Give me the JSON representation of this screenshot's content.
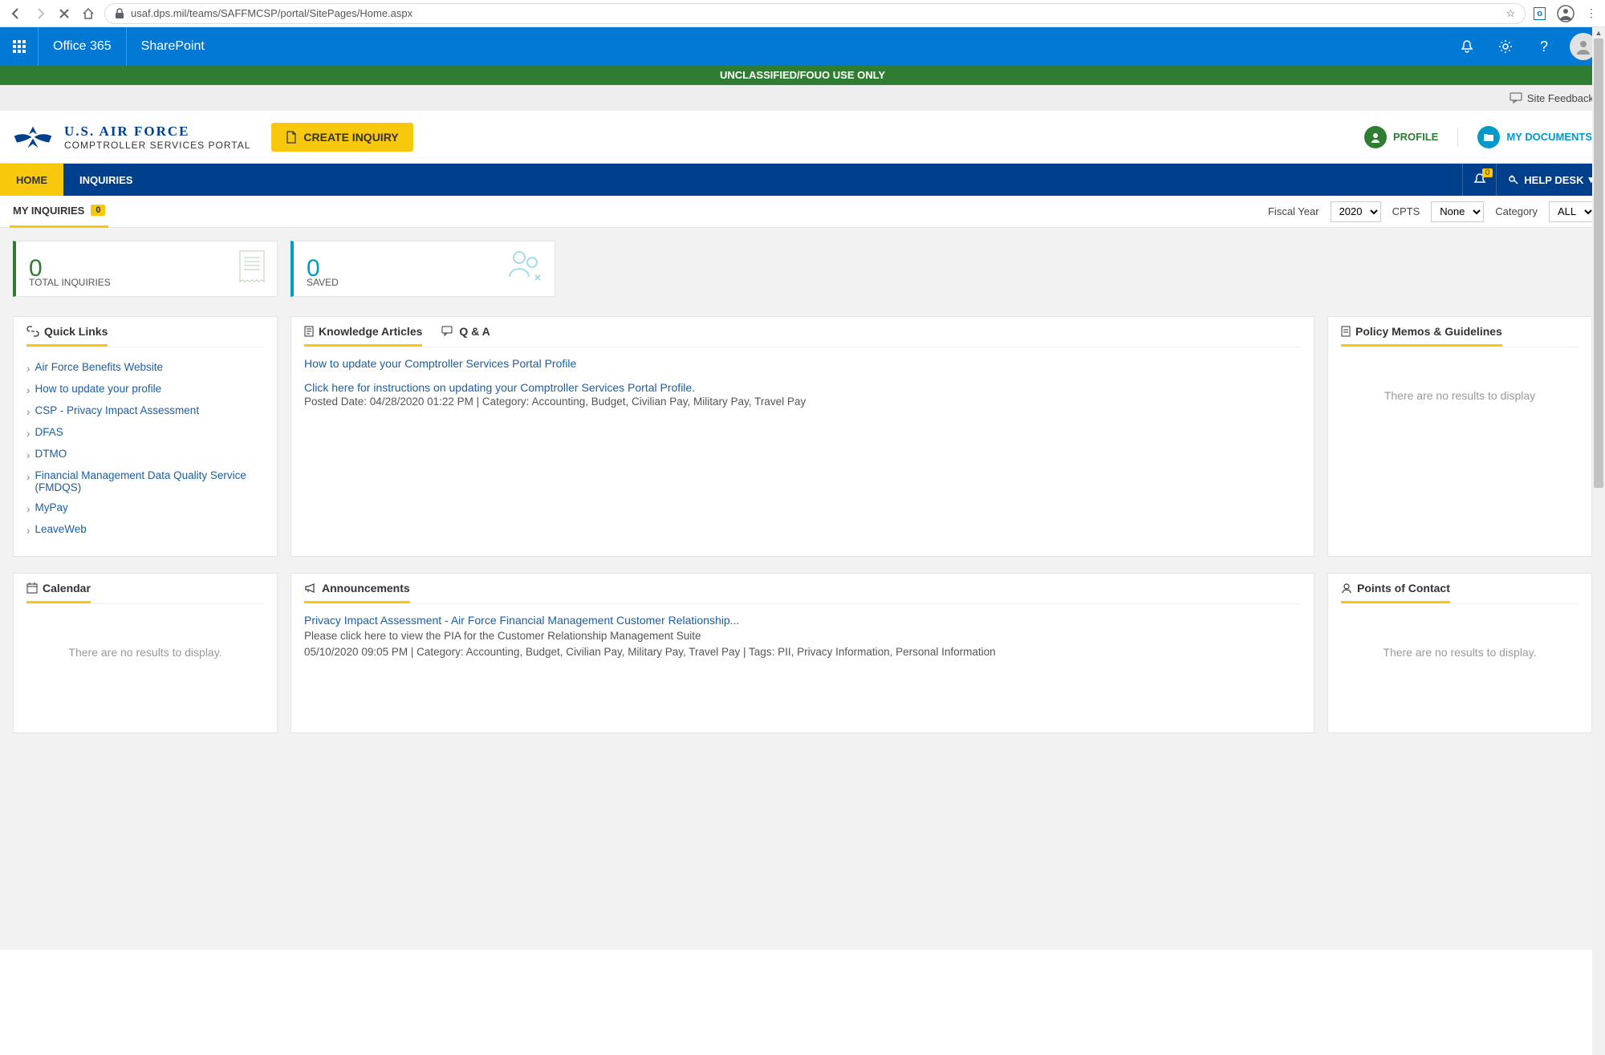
{
  "browser": {
    "url": "usaf.dps.mil/teams/SAFFMCSP/portal/SitePages/Home.aspx"
  },
  "o365": {
    "office": "Office 365",
    "sp": "SharePoint"
  },
  "classification": "UNCLASSIFIED/FOUO USE ONLY",
  "feedback": "Site Feedback",
  "header": {
    "title": "U.S. AIR FORCE",
    "subtitle": "COMPTROLLER SERVICES PORTAL",
    "create": "CREATE INQUIRY",
    "profile": "PROFILE",
    "docs": "MY DOCUMENTS"
  },
  "nav": {
    "home": "HOME",
    "inquiries": "INQUIRIES",
    "help": "HELP DESK",
    "bell_badge": "0"
  },
  "filter": {
    "my_inq": "MY INQUIRIES",
    "count": "0",
    "fy_label": "Fiscal Year",
    "fy_val": "2020",
    "cpts_label": "CPTS",
    "cpts_val": "None",
    "cat_label": "Category",
    "cat_val": "ALL"
  },
  "stats": {
    "total_num": "0",
    "total_lbl": "TOTAL INQUIRIES",
    "saved_num": "0",
    "saved_lbl": "SAVED"
  },
  "quicklinks": {
    "title": "Quick Links",
    "items": [
      "Air Force Benefits Website",
      "How to update your profile",
      "CSP - Privacy Impact Assessment",
      "DFAS",
      "DTMO",
      "Financial Management Data Quality Service (FMDQS)",
      "MyPay",
      "LeaveWeb"
    ]
  },
  "knowledge": {
    "tab1": "Knowledge Articles",
    "tab2": "Q & A",
    "art_title": "How to update your Comptroller Services Portal Profile",
    "art_link": "Click here for instructions on updating your Comptroller Services Portal Profile.",
    "art_meta": "Posted Date: 04/28/2020 01:22 PM | Category: Accounting, Budget, Civilian Pay, Military Pay, Travel Pay"
  },
  "policy": {
    "title": "Policy Memos & Guidelines",
    "empty": "There are no results to display"
  },
  "calendar": {
    "title": "Calendar",
    "empty": "There are no results to display."
  },
  "announcements": {
    "title": "Announcements",
    "a_title": "Privacy Impact Assessment - Air Force Financial Management Customer Relationship...",
    "a_sub": "Please click here to view the PIA for the Customer Relationship Management Suite",
    "a_meta": "05/10/2020 09:05 PM | Category: Accounting, Budget, Civilian Pay, Military Pay, Travel Pay | Tags: PII, Privacy Information, Personal Information"
  },
  "poc": {
    "title": "Points of Contact",
    "empty": "There are no results to display."
  }
}
